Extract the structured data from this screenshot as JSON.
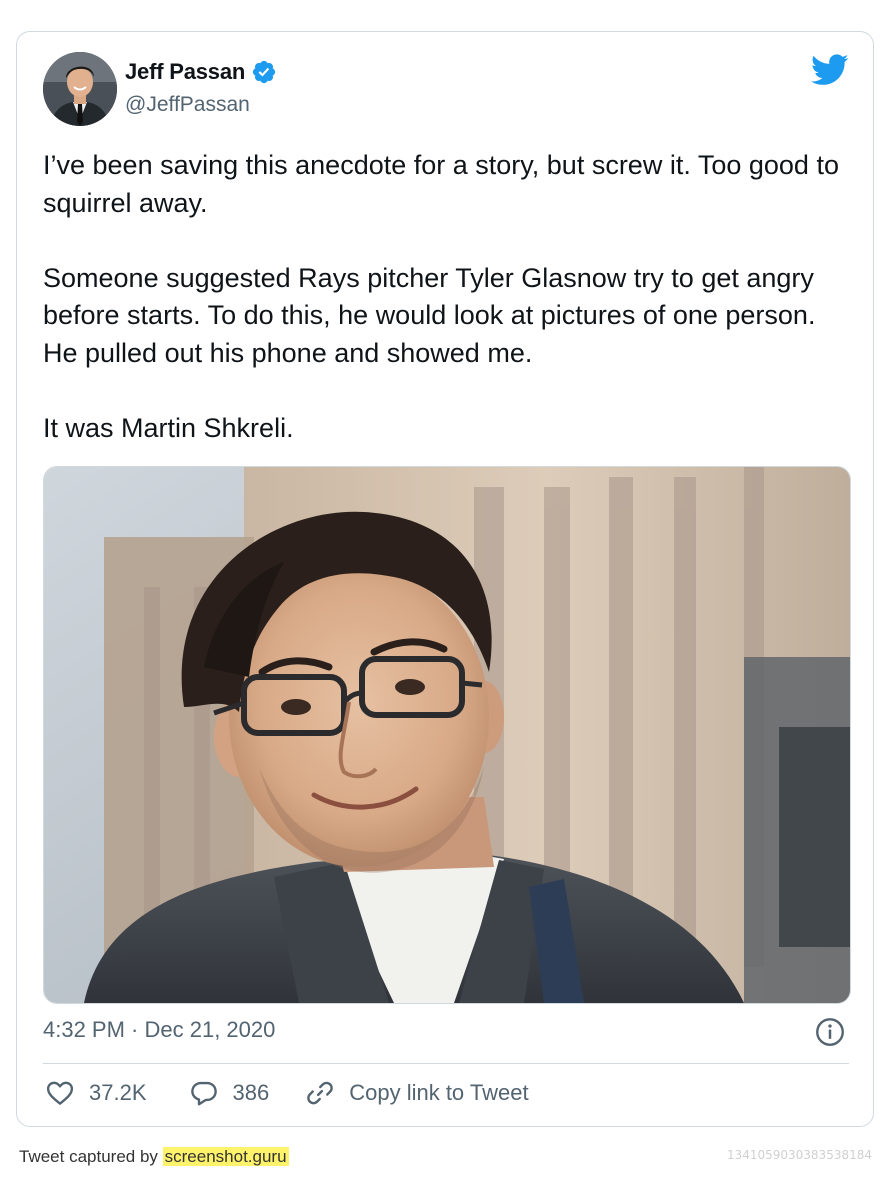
{
  "author": {
    "name": "Jeff Passan",
    "handle": "@JeffPassan",
    "verified": true
  },
  "tweet": {
    "paragraphs": [
      "I’ve been saving this anecdote for a story, but screw it. Too good to squirrel away.",
      "Someone suggested Rays pitcher Tyler Glasnow try to get angry before starts. To do this, he would look at pictures of one person. He pulled out his phone and showed me.",
      "It was Martin Shkreli."
    ],
    "time": "4:32 PM",
    "separator": " · ",
    "date": "Dec 21, 2020"
  },
  "actions": {
    "likes": "37.2K",
    "replies": "386",
    "copy_link_label": "Copy link to Tweet"
  },
  "footer": {
    "captured_by_prefix": "Tweet captured by ",
    "captured_by_brand": "screenshot.guru",
    "tweet_id": "1341059030383538184"
  },
  "colors": {
    "twitter_blue": "#1d9bf0",
    "text_primary": "#0f1419",
    "text_secondary": "#536471",
    "border": "#cfd9de",
    "highlight": "#fff36b"
  },
  "icons": [
    "verified-badge-icon",
    "twitter-bird-icon",
    "info-icon",
    "heart-icon",
    "reply-bubble-icon",
    "link-icon"
  ]
}
